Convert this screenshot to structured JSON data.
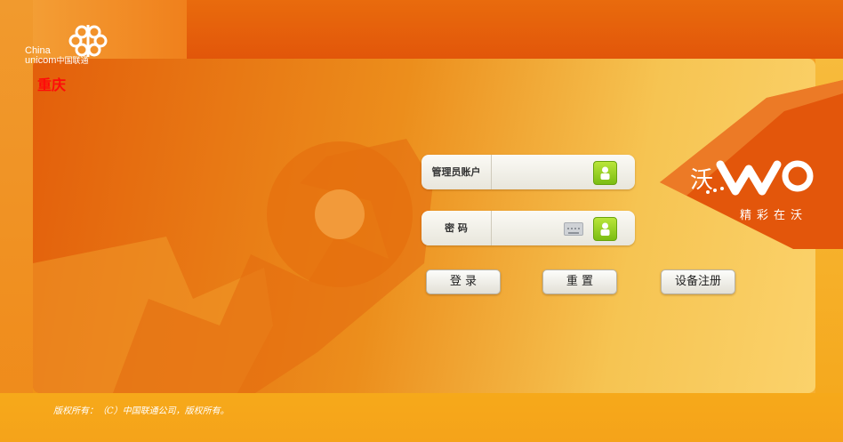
{
  "brand": {
    "logo_en_line1": "China",
    "logo_en_line2": "unicom",
    "logo_cn": "中国联通",
    "city": "重庆"
  },
  "wo": {
    "character": "沃",
    "slogan": "精彩在沃"
  },
  "login": {
    "account_label": "管理员账户",
    "password_label": "密 码",
    "account_value": "",
    "password_value": ""
  },
  "buttons": {
    "login": "登 录",
    "reset": "重 置",
    "register": "设备注册"
  },
  "footer": {
    "copyright": "版权所有：（C）中国联通公司，版权所有。"
  },
  "colors": {
    "brand_orange": "#e2560a",
    "city_red": "#ff0a0a",
    "accent_green": "#7bbd12"
  }
}
